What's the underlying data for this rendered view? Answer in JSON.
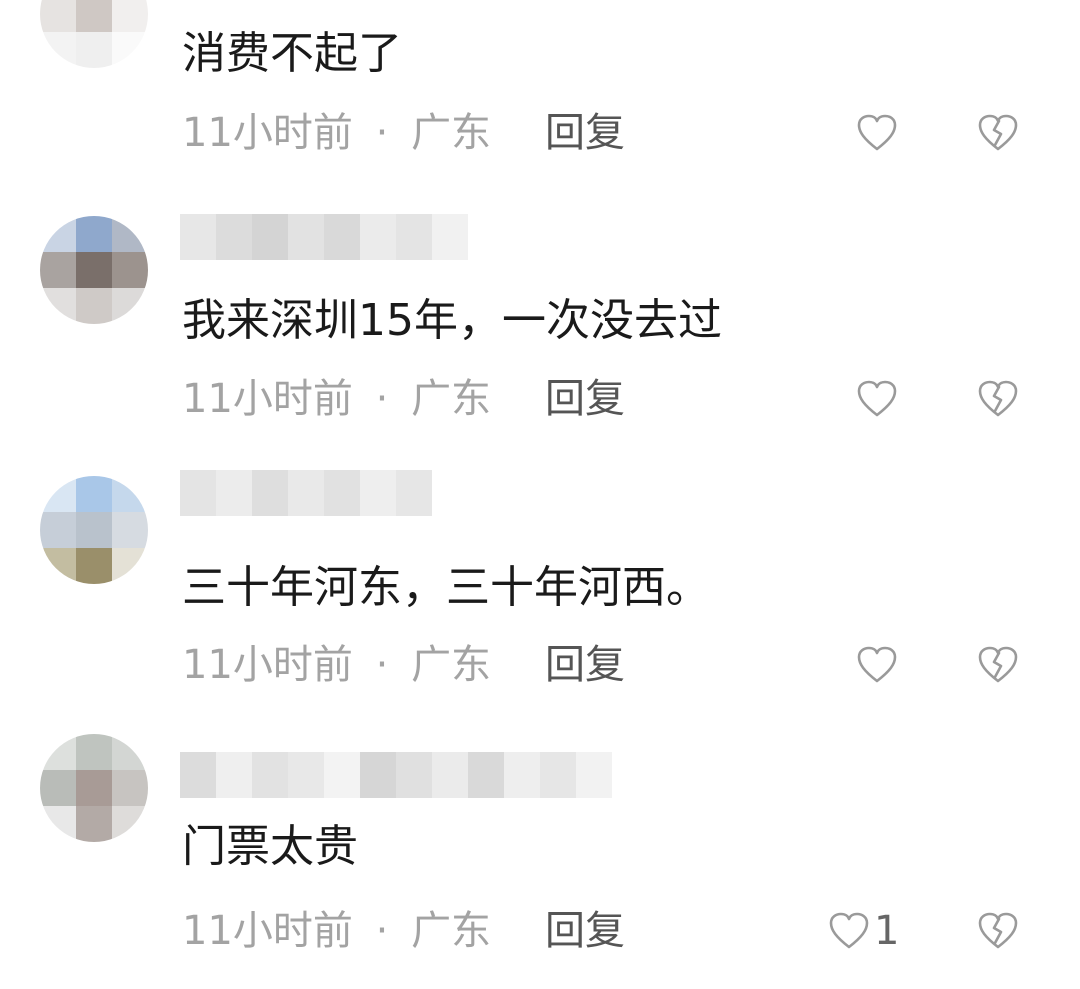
{
  "comments": [
    {
      "text": "消费不起了",
      "time": "11小时前",
      "sep": "·",
      "location": "广东",
      "reply_label": "回复",
      "like_count": ""
    },
    {
      "text": "我来深圳15年，一次没去过",
      "time": "11小时前",
      "sep": "·",
      "location": "广东",
      "reply_label": "回复",
      "like_count": ""
    },
    {
      "text": "三十年河东，三十年河西。",
      "time": "11小时前",
      "sep": "·",
      "location": "广东",
      "reply_label": "回复",
      "like_count": ""
    },
    {
      "text": "门票太贵",
      "time": "11小时前",
      "sep": "·",
      "location": "广东",
      "reply_label": "回复",
      "like_count": "1"
    }
  ],
  "colors": {
    "text": "#1a1a1a",
    "meta": "#a3a3a3",
    "reply": "#555555",
    "icon": "#9a9a9a"
  },
  "icons": {
    "like": "heart-outline-icon",
    "dislike": "broken-heart-icon"
  }
}
